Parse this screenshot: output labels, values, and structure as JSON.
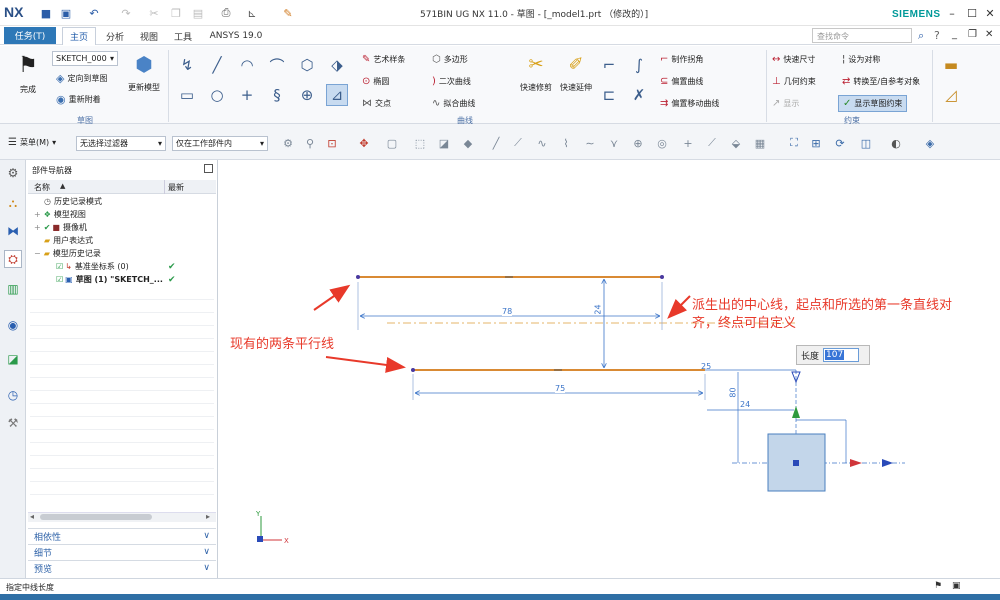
{
  "titlebar": {
    "logo": "NX",
    "title": "571BIN UG NX 11.0 - 草图 - [_model1.prt （修改的）]",
    "brand": "SIEMENS"
  },
  "menubar": {
    "task": "任务(T)",
    "tabs": [
      "主页",
      "分析",
      "视图",
      "工具",
      "ANSYS 19.0"
    ],
    "search_placeholder": "查找命令"
  },
  "ribbon": {
    "sketch_group": {
      "finish": "完成",
      "sketch_name": "SKETCH_000",
      "orient": "定向到草图",
      "reattach": "重新附着",
      "update": "更新模型",
      "label": "草图"
    },
    "curve_group": {
      "art_spline": "艺术样条",
      "polygon": "多边形",
      "ellipse": "椭圆",
      "conic": "二次曲线",
      "intersection": "交点",
      "fit_curve": "拟合曲线",
      "quick_trim": "快速修剪",
      "quick_extend": "快速延伸",
      "make_corner": "制作拐角",
      "offset_curve": "偏置曲线",
      "pattern_curve": "阵列曲线",
      "offset_move": "偏置移动曲线",
      "label": "曲线"
    },
    "constraint_group": {
      "quick_dim": "快速尺寸",
      "geo_con": "几何约束",
      "relax": "显示",
      "make_sym": "设为对称",
      "convert_ref": "转换至/自参考对象",
      "show_con": "显示草图约束",
      "label": "约束"
    }
  },
  "toolbar": {
    "menu": "菜单(M)",
    "filter": "无选择过滤器",
    "scope": "仅在工作部件内"
  },
  "navigator": {
    "title": "部件导航器",
    "col_name": "名称",
    "col_latest": "最新",
    "rows": [
      {
        "label": "历史记录模式",
        "check": ""
      },
      {
        "label": "模型视图",
        "check": ""
      },
      {
        "label": "摄像机",
        "check": ""
      },
      {
        "label": "用户表达式",
        "check": ""
      },
      {
        "label": "模型历史记录",
        "check": ""
      },
      {
        "label": "基准坐标系 (0)",
        "check": "✔"
      },
      {
        "label": "草图 (1) \"SKETCH_...",
        "check": "✔"
      }
    ],
    "accordion": [
      "相依性",
      "细节",
      "预览"
    ]
  },
  "canvas": {
    "dims": {
      "d78": "78",
      "d24a": "24",
      "d75": "75",
      "d25": "25",
      "d80": "80",
      "d24b": "24"
    },
    "annotation_right": [
      "派生出的中心线，起点和所选的第一条直线对",
      "齐，终点可自定义"
    ],
    "annotation_left": "现有的两条平行线",
    "length_label": "长度",
    "length_value": "107"
  },
  "status": {
    "prompt": "指定中线长度"
  }
}
